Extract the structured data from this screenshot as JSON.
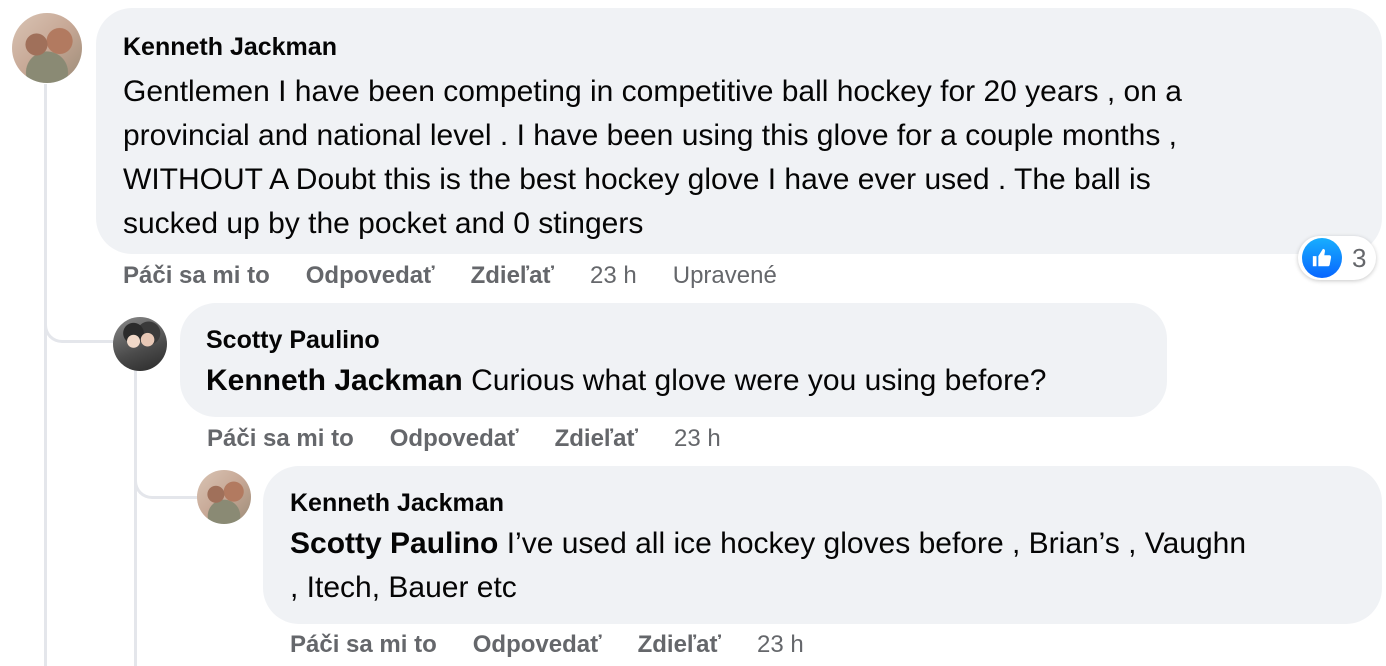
{
  "comments": [
    {
      "author": "Kenneth Jackman",
      "lines": [
        "Gentlemen I have been competing in competitive ball hockey for 20 years , on a",
        "provincial and national level . I have been using this glove for a couple months ,",
        "WITHOUT A Doubt this is the best hockey glove I have ever used . The ball is",
        "sucked up by the pocket and 0 stingers"
      ],
      "actions": {
        "like": "Páči sa mi to",
        "reply": "Odpovedať",
        "share": "Zdieľať"
      },
      "time": "23 h",
      "edited": "Upravené",
      "reaction_count": "3"
    },
    {
      "author": "Scotty Paulino",
      "mention": "Kenneth Jackman",
      "text": " Curious what glove were you using before?",
      "actions": {
        "like": "Páči sa mi to",
        "reply": "Odpovedať",
        "share": "Zdieľať"
      },
      "time": "23 h"
    },
    {
      "author": "Kenneth Jackman",
      "mention": "Scotty Paulino",
      "text_line1": " I’ve used all ice hockey gloves before , Brian’s , Vaughn",
      "text_line2": ", Itech, Bauer etc",
      "actions": {
        "like": "Páči sa mi to",
        "reply": "Odpovedať",
        "share": "Zdieľať"
      },
      "time": "23 h"
    }
  ],
  "icons": {
    "like": "thumbs-up-icon",
    "like_color": "#0866ff"
  }
}
